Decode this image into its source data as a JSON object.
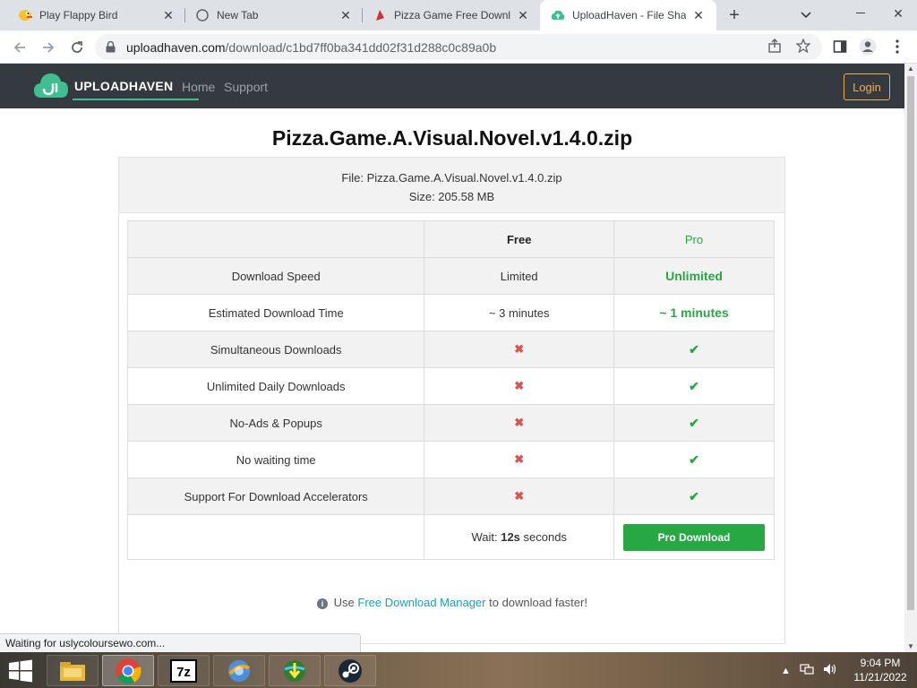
{
  "browser": {
    "tabs": [
      {
        "title": "Play Flappy Bird",
        "icon": "flappy-bird-icon"
      },
      {
        "title": "New Tab",
        "icon": "globe-icon"
      },
      {
        "title": "Pizza Game Free Downlo...",
        "icon": "pizza-icon"
      },
      {
        "title": "UploadHaven - File Shari...",
        "icon": "uploadhaven-icon"
      }
    ],
    "url_host": "uploadhaven.com",
    "url_path": "/download/c1bd7ff0ba341dd02f31d288c0c89a0b",
    "status_text": "Waiting for uslycoloursewo.com..."
  },
  "site": {
    "logo_upload": "UPLOAD",
    "logo_haven": "HAVEN",
    "nav": [
      "Home",
      "Support"
    ],
    "login_label": "Login",
    "accent": "#28a745",
    "login_color": "#f0ad4e"
  },
  "download": {
    "title": "Pizza.Game.A.Visual.Novel.v1.4.0.zip",
    "file_line": "File: Pizza.Game.A.Visual.Novel.v1.4.0.zip",
    "size_line": "Size: 205.58 MB",
    "col_free": "Free",
    "col_pro": "Pro",
    "rows": [
      {
        "feature": "Download Speed",
        "free": "Limited",
        "pro": "Unlimited"
      },
      {
        "feature": "Estimated Download Time",
        "free": "~ 3 minutes",
        "pro": "~ 1 minutes"
      },
      {
        "feature": "Simultaneous Downloads",
        "free": "✖",
        "pro": "✔"
      },
      {
        "feature": "Unlimited Daily Downloads",
        "free": "✖",
        "pro": "✔"
      },
      {
        "feature": "No-Ads & Popups",
        "free": "✖",
        "pro": "✔"
      },
      {
        "feature": "No waiting time",
        "free": "✖",
        "pro": "✔"
      },
      {
        "feature": "Support For Download Accelerators",
        "free": "✖",
        "pro": "✔"
      }
    ],
    "wait_prefix": "Wait:",
    "wait_value": "12s",
    "wait_suffix": "seconds",
    "pro_button": "Pro Download",
    "fdm_prefix": "Use",
    "fdm_link": "Free Download Manager",
    "fdm_suffix": "to download faster!"
  },
  "taskbar": {
    "apps": [
      "file-explorer-icon",
      "chrome-icon",
      "7zip-icon",
      "browser-icon",
      "download-manager-icon",
      "steam-icon"
    ],
    "time": "9:04 PM",
    "date": "11/21/2022"
  }
}
